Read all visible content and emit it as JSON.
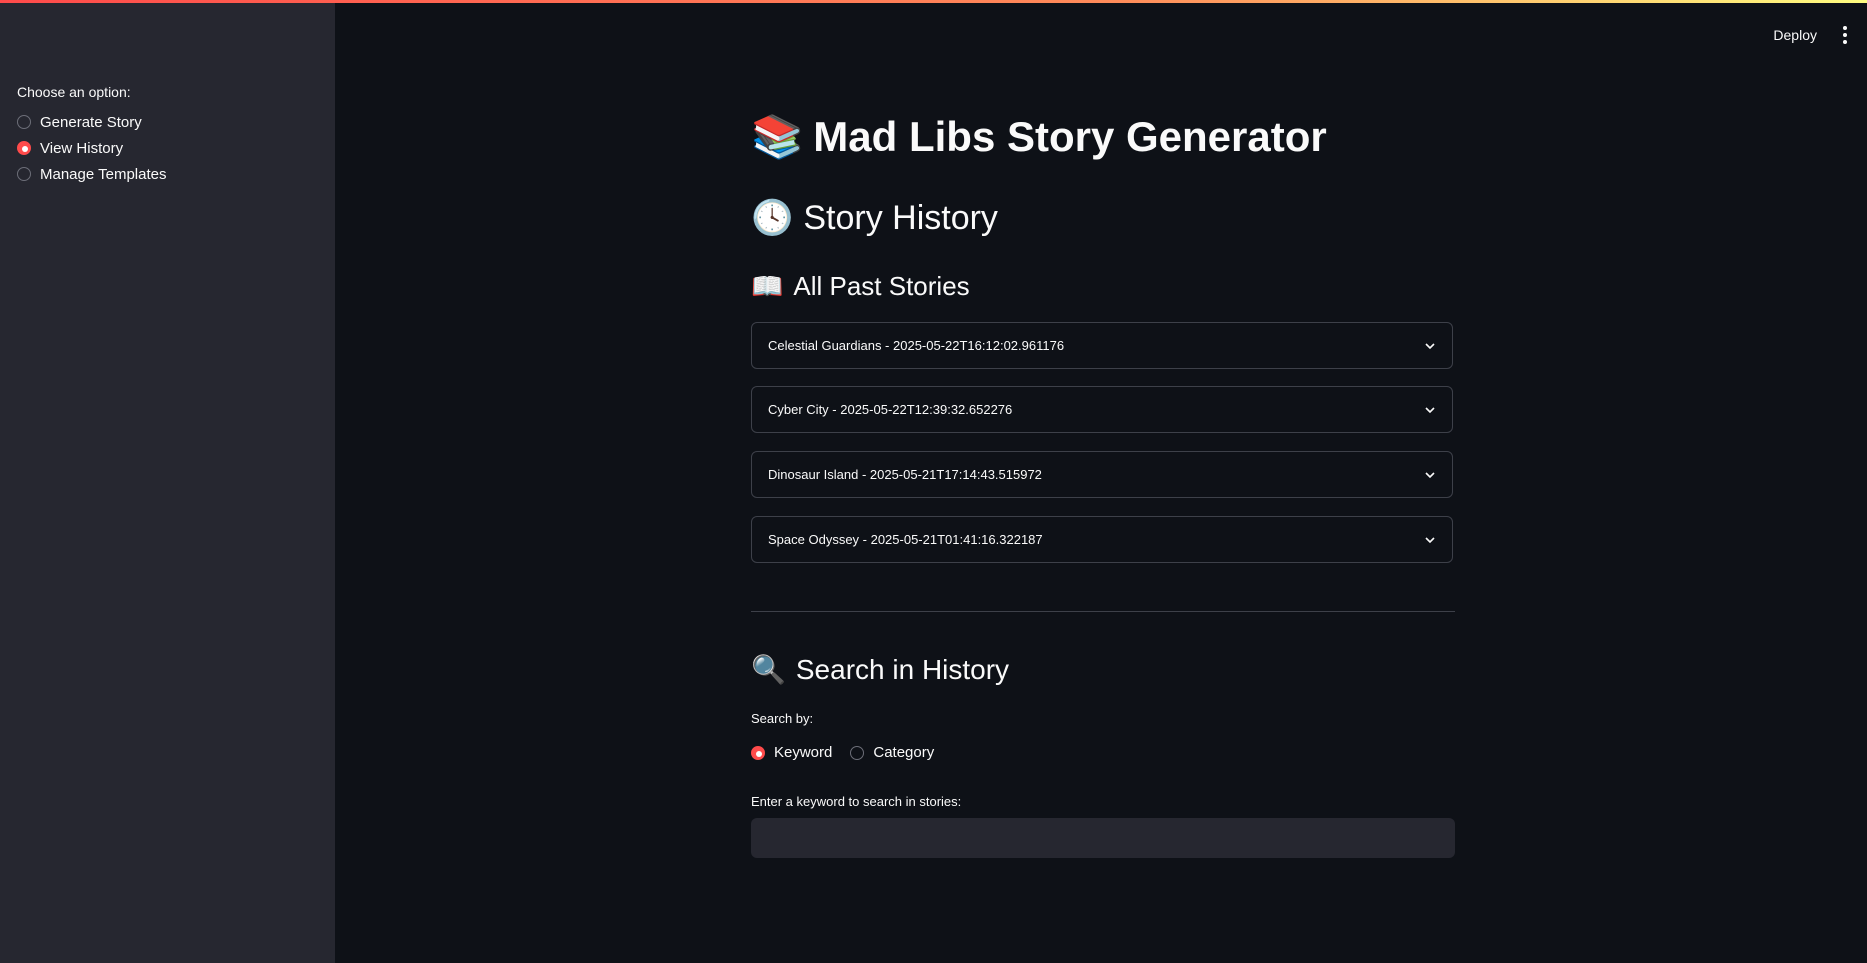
{
  "sidebar": {
    "label": "Choose an option:",
    "options": [
      {
        "label": "Generate Story",
        "selected": false
      },
      {
        "label": "View History",
        "selected": true
      },
      {
        "label": "Manage Templates",
        "selected": false
      }
    ]
  },
  "header": {
    "deploy_label": "Deploy",
    "menu_icon": "vertical-ellipsis-icon"
  },
  "main": {
    "title_emoji": "📚",
    "title": "Mad Libs Story Generator",
    "subtitle_emoji": "🕓",
    "subtitle": "Story History",
    "section_emoji": "📖",
    "section": "All Past Stories",
    "stories": [
      "Celestial Guardians - 2025-05-22T16:12:02.961176",
      "Cyber City - 2025-05-22T12:39:32.652276",
      "Dinosaur Island - 2025-05-21T17:14:43.515972",
      "Space Odyssey - 2025-05-21T01:41:16.322187"
    ],
    "search_emoji": "🔍",
    "search_heading": "Search in History",
    "search_by_label": "Search by:",
    "search_options": [
      {
        "label": "Keyword",
        "selected": true
      },
      {
        "label": "Category",
        "selected": false
      }
    ],
    "keyword_label": "Enter a keyword to search in stories:",
    "keyword_value": ""
  },
  "colors": {
    "accent": "#ff4b4b",
    "background": "#0e1117",
    "sidebar": "#262730"
  }
}
